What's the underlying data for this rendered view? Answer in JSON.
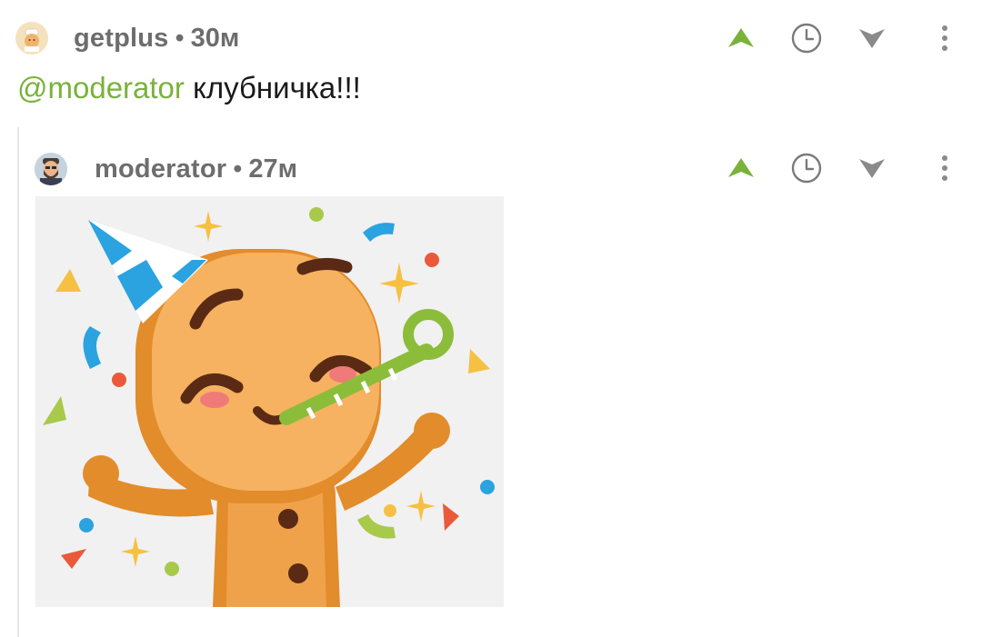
{
  "comment": {
    "author": "getplus",
    "separator": "•",
    "time": "30м",
    "mention": "@moderator",
    "text": " клубничка!!!"
  },
  "reply": {
    "author": "moderator",
    "separator": "•",
    "time": "27м",
    "sticker_icon": "gingerbread-party-sticker"
  },
  "icons": {
    "upvote": "arrow-up-icon",
    "history": "clock-icon",
    "downvote": "arrow-down-icon",
    "menu": "more-vertical-icon"
  },
  "colors": {
    "accent_green": "#7ab23a",
    "muted_gray": "#6d6d6d",
    "icon_gray": "#8a8a8a"
  }
}
